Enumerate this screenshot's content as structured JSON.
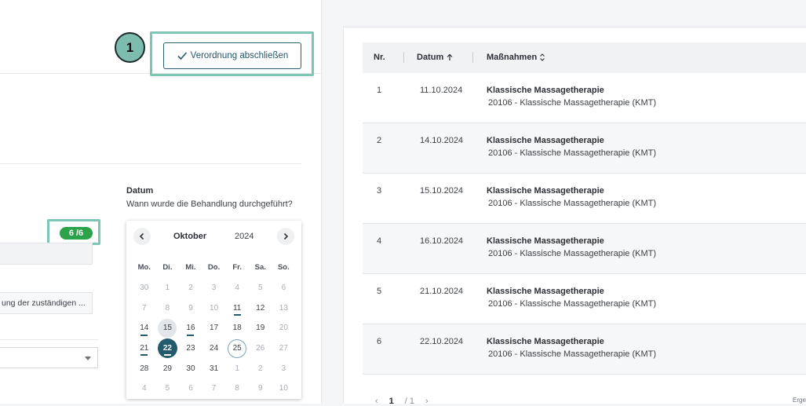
{
  "step_badge": "1",
  "complete_button": "Verordnung abschließen",
  "date_field": {
    "title": "Datum",
    "question": "Wann wurde die Behandlung durchgeführt?"
  },
  "count_badge": "6 /6",
  "truncated_field": "ung der zuständigen ...",
  "calendar": {
    "month": "Oktober",
    "year": "2024",
    "prev_icon": "chevron-left-icon",
    "next_icon": "chevron-right-icon",
    "weekdays": [
      "Mo.",
      "Di.",
      "Mi.",
      "Do.",
      "Fr.",
      "Sa.",
      "So."
    ],
    "weeks": [
      [
        "30",
        "1",
        "2",
        "3",
        "4",
        "5",
        "6"
      ],
      [
        "7",
        "8",
        "9",
        "10",
        "11",
        "12",
        "13"
      ],
      [
        "14",
        "15",
        "16",
        "17",
        "18",
        "19",
        "20"
      ],
      [
        "21",
        "22",
        "23",
        "24",
        "25",
        "26",
        "27"
      ],
      [
        "28",
        "29",
        "30",
        "31",
        "1",
        "2",
        "3"
      ],
      [
        "4",
        "5",
        "6",
        "7",
        "8",
        "9",
        "10"
      ]
    ]
  },
  "table": {
    "headers": {
      "nr": "Nr.",
      "datum": "Datum",
      "massnahmen": "Maßnahmen"
    },
    "sort_icons": {
      "datum": "arrow-up-icon",
      "massnahmen": "sort-updown-icon"
    },
    "rows": [
      {
        "nr": "1",
        "datum": "11.10.2024",
        "title": "Klassische Massagetherapie",
        "sub": "20106 - Klassische Massagetherapie (KMT)"
      },
      {
        "nr": "2",
        "datum": "14.10.2024",
        "title": "Klassische Massagetherapie",
        "sub": "20106 - Klassische Massagetherapie (KMT)"
      },
      {
        "nr": "3",
        "datum": "15.10.2024",
        "title": "Klassische Massagetherapie",
        "sub": "20106 - Klassische Massagetherapie (KMT)"
      },
      {
        "nr": "4",
        "datum": "16.10.2024",
        "title": "Klassische Massagetherapie",
        "sub": "20106 - Klassische Massagetherapie (KMT)"
      },
      {
        "nr": "5",
        "datum": "21.10.2024",
        "title": "Klassische Massagetherapie",
        "sub": "20106 - Klassische Massagetherapie (KMT)"
      },
      {
        "nr": "6",
        "datum": "22.10.2024",
        "title": "Klassische Massagetherapie",
        "sub": "20106 - Klassische Massagetherapie (KMT)"
      }
    ]
  },
  "pager": {
    "current": "1",
    "total": "/ 1"
  },
  "results_label": "Erge"
}
